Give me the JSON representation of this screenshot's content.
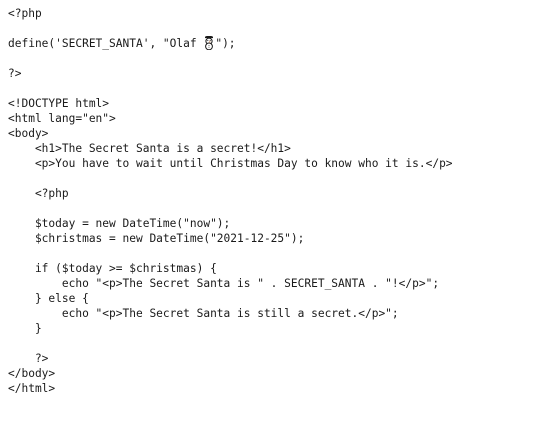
{
  "code": {
    "language": "php",
    "snowman_icon": "snowman-icon",
    "lines": [
      "<?php",
      "",
      "define('SECRET_SANTA', \"Olaf ",
      "\");",
      "",
      "?>",
      "",
      "<!DOCTYPE html>",
      "<html lang=\"en\">",
      "<body>",
      "    <h1>The Secret Santa is a secret!</h1>",
      "    <p>You have to wait until Christmas Day to know who it is.</p>",
      "",
      "    <?php",
      "",
      "    $today = new DateTime(\"now\");",
      "    $christmas = new DateTime(\"2021-12-25\");",
      "",
      "    if ($today >= $christmas) {",
      "        echo \"<p>The Secret Santa is \" . SECRET_SANTA . \"!</p>\";",
      "    } else {",
      "        echo \"<p>The Secret Santa is still a secret.</p>\";",
      "    }",
      "",
      "    ?>",
      "</body>",
      "</html>"
    ]
  }
}
